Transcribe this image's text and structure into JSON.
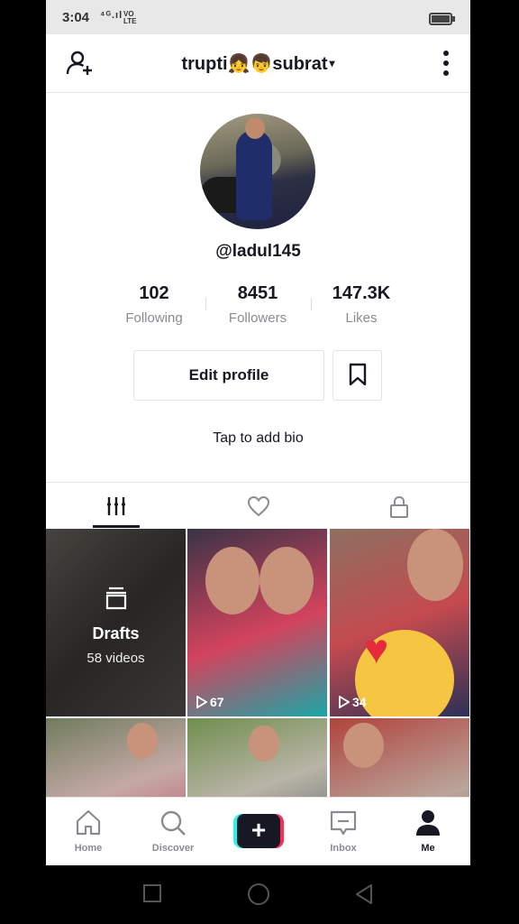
{
  "status_bar": {
    "time": "3:04",
    "signal": "⁴ᴳ.ıl",
    "volte": "VO\nLTE"
  },
  "header": {
    "account_name": "trupti👧👦subrat",
    "caret": "▾"
  },
  "profile": {
    "username": "@ladul145",
    "stats": [
      {
        "value": "102",
        "label": "Following"
      },
      {
        "value": "8451",
        "label": "Followers"
      },
      {
        "value": "147.3K",
        "label": "Likes"
      }
    ],
    "edit_profile_label": "Edit profile",
    "bio_prompt": "Tap to add bio"
  },
  "content_tabs": [
    {
      "name": "videos",
      "icon": "grid-icon",
      "active": true
    },
    {
      "name": "liked",
      "icon": "heart-icon",
      "active": false
    },
    {
      "name": "private",
      "icon": "lock-icon",
      "active": false
    }
  ],
  "videos": {
    "drafts": {
      "title": "Drafts",
      "count_label": "58 videos"
    },
    "items": [
      {
        "views": "67"
      },
      {
        "views": "34"
      }
    ]
  },
  "bottom_nav": {
    "items": [
      {
        "label": "Home",
        "icon": "home-icon"
      },
      {
        "label": "Discover",
        "icon": "search-icon"
      },
      {
        "label": "",
        "icon": "plus-icon"
      },
      {
        "label": "Inbox",
        "icon": "inbox-icon"
      },
      {
        "label": "Me",
        "icon": "person-icon",
        "active": true
      }
    ]
  },
  "colors": {
    "text": "#161823",
    "secondary": "#8a8b91",
    "accent_cyan": "#25f4ee",
    "accent_red": "#fe2c55"
  }
}
